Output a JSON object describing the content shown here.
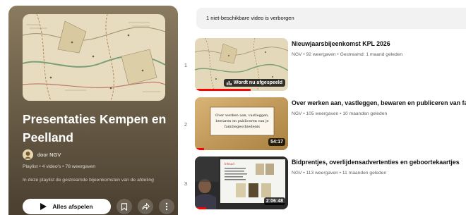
{
  "playlist": {
    "title": "Presentaties Kempen en Peelland",
    "owner": "door NGV",
    "meta": "Playlist • 4 video's • 78 weergaven",
    "description": "In deze playlist de gestreamde bijeenkomsten van de afdeling",
    "play_all_label": "Alles afspelen",
    "icons": {
      "play": "play-icon",
      "save": "bookmark-icon",
      "share": "share-icon",
      "more": "more-vert-icon",
      "owner": "ngv-logo-avatar"
    }
  },
  "hidden_notice": "1 niet-beschikbare video is verborgen",
  "videos": [
    {
      "index": "1",
      "title": "Nieuwjaarsbijeenkomst KPL 2026",
      "meta": "NGV • 92 weergaven • Gestreamd: 1 maand geleden",
      "badge": "Wordt nu afgespeeld",
      "watched": 0.6
    },
    {
      "index": "2",
      "title": "Over werken aan, vastleggen, bewaren en publiceren van familiegeschiedenis",
      "meta": "NGV • 105 weergaven • 10 maanden geleden",
      "duration": "54:17",
      "thumb_text": [
        "Over werken aan, vastleggen,",
        "bewaren en publiceren van je",
        "familiegeschiedenis"
      ],
      "watched": 0.1
    },
    {
      "index": "3",
      "title": "Bidprentjes, overlijdensadvertenties en geboortekaartjes",
      "meta": "NGV • 113 weergaven • 11 maanden geleden",
      "duration": "2:06:48",
      "thumb_text": [
        "Inhoud"
      ],
      "watched": 0.12
    }
  ],
  "colors": {
    "accent_red": "#ff0000",
    "panel_brown": "#6c5f49",
    "notice_bg": "#f2f2f2"
  }
}
